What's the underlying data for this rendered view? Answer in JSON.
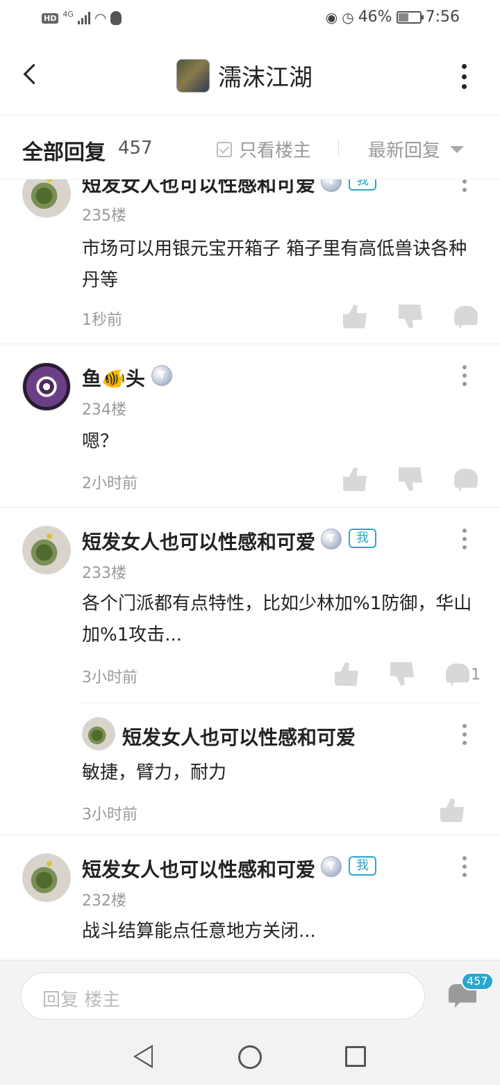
{
  "status_bar": {
    "hd": "HD",
    "network": "4G",
    "battery_percent": "46%",
    "battery_level": 0.46,
    "time": "7:56",
    "icons": [
      "signal-icon",
      "wifi-icon",
      "qq-icon",
      "eye-icon",
      "alarm-icon",
      "battery-icon"
    ]
  },
  "header": {
    "title": "濡沫江湖",
    "back_icon": "back-arrow-icon",
    "more_icon": "more-vertical-icon"
  },
  "filter_bar": {
    "all_replies_label": "全部回复",
    "reply_count": "457",
    "only_op_label": "只看楼主",
    "only_op_checked": false,
    "sort_label": "最新回复"
  },
  "posts": [
    {
      "username": "短发女人也可以性感和可爱",
      "badge": "T",
      "me_tag": "我",
      "floor": "235楼",
      "content": "市场可以用银元宝开箱子  箱子里有高低兽诀各种丹等",
      "time": "1秒前"
    },
    {
      "username": "鱼🐠头",
      "badge": "T",
      "floor": "234楼",
      "content": "嗯？",
      "time": "2小时前"
    },
    {
      "username": "短发女人也可以性感和可爱",
      "badge": "T",
      "me_tag": "我",
      "floor": "233楼",
      "content": "各个门派都有点特性，比如少林加%1防御，华山加%1攻击...",
      "time": "3小时前",
      "comment_count": "1",
      "sub_reply": {
        "username": "短发女人也可以性感和可爱",
        "content": "敏捷，臂力，耐力",
        "time": "3小时前"
      }
    },
    {
      "username": "短发女人也可以性感和可爱",
      "badge": "T",
      "me_tag": "我",
      "floor": "232楼",
      "content": "战斗结算能点任意地方关闭..."
    }
  ],
  "reply_bar": {
    "placeholder": "回复  楼主",
    "badge_count": "457"
  },
  "nav_bar": {
    "icons": [
      "nav-back-icon",
      "nav-home-icon",
      "nav-recent-icon"
    ]
  }
}
